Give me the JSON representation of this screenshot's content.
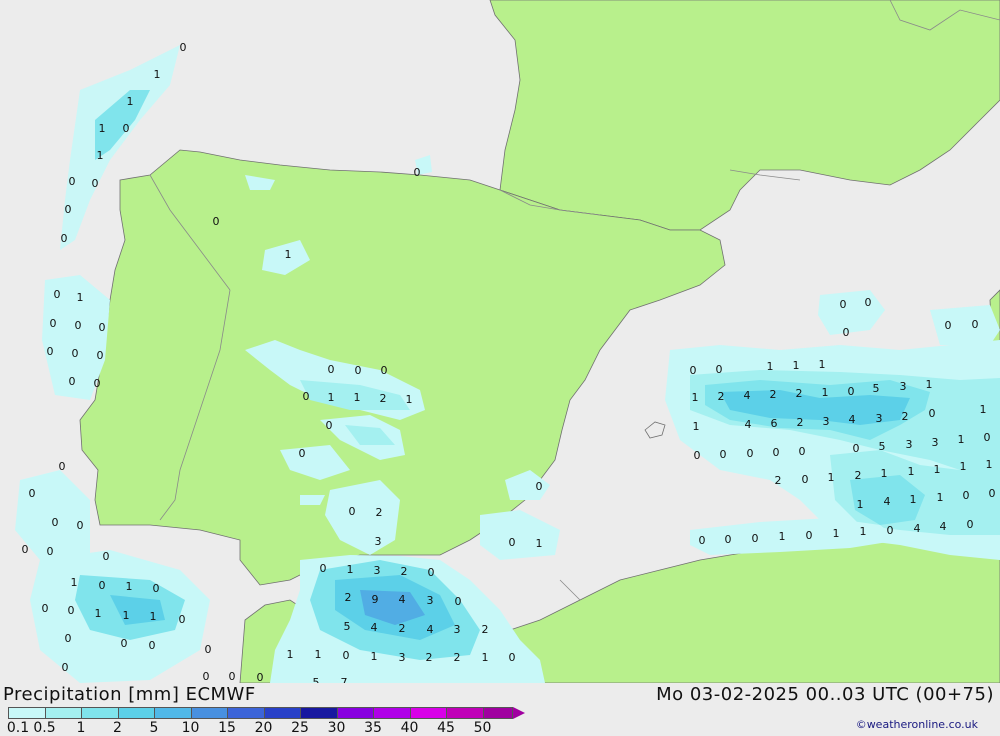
{
  "header": {
    "title": "Precipitation [mm] ECMWF",
    "datetime": "Mo 03-02-2025 00..03 UTC (00+75)",
    "credit": "©weatheronline.co.uk"
  },
  "colors": {
    "land": "#b8f08c",
    "sea": "#ececec",
    "border": "#8a8a8a",
    "coast": "#707070"
  },
  "legend": {
    "labels": [
      "0.1",
      "0.5",
      "1",
      "2",
      "5",
      "10",
      "15",
      "20",
      "25",
      "30",
      "35",
      "40",
      "45",
      "50"
    ],
    "colors": [
      "#c8f8f8",
      "#a4f0f0",
      "#80e4ec",
      "#5cd0e8",
      "#50b8e8",
      "#4890e0",
      "#3c64d8",
      "#2840c8",
      "#1818a0",
      "#8800e0",
      "#b000e8",
      "#d800e8",
      "#c000b8",
      "#a000a0"
    ]
  },
  "map_values": [
    "0",
    "1",
    "1",
    "1",
    "0",
    "1",
    "0",
    "0",
    "0",
    "0",
    "0",
    "1",
    "0",
    "0",
    "0",
    "0",
    "0",
    "0",
    "0",
    "0",
    "0",
    "0",
    "0",
    "0",
    "0",
    "0",
    "1",
    "0",
    "1",
    "0",
    "0",
    "0",
    "0",
    "0",
    "1",
    "1",
    "0",
    "0",
    "0",
    "1",
    "0",
    "0",
    "0",
    "1",
    "1",
    "2",
    "1",
    "0",
    "1",
    "0",
    "0",
    "2",
    "3",
    "0",
    "1",
    "3",
    "2",
    "0",
    "2",
    "9",
    "4",
    "3",
    "0",
    "5",
    "4",
    "2",
    "4",
    "3",
    "2",
    "1",
    "1",
    "0",
    "1",
    "3",
    "2",
    "2",
    "1",
    "0",
    "5",
    "7",
    "0",
    "0",
    "0",
    "0",
    "0",
    "0",
    "0",
    "0",
    "0",
    "0",
    "1",
    "0",
    "0",
    "0",
    "0",
    "5",
    "3",
    "1",
    "1",
    "2",
    "4",
    "2",
    "2",
    "1",
    "0",
    "0",
    "0",
    "1",
    "1",
    "1",
    "4",
    "6",
    "2",
    "3",
    "4",
    "3",
    "2",
    "1",
    "0",
    "0",
    "0",
    "0",
    "0",
    "0",
    "0",
    "5",
    "3",
    "3",
    "1",
    "0",
    "2",
    "0",
    "1",
    "2",
    "1",
    "1",
    "1",
    "1",
    "1",
    "1",
    "1",
    "4",
    "1",
    "1",
    "0",
    "0",
    "0",
    "0",
    "0",
    "1",
    "0",
    "1",
    "1",
    "0",
    "4",
    "4",
    "0",
    "0"
  ]
}
